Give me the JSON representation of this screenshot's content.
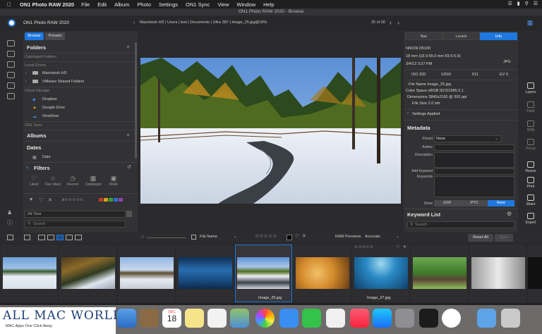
{
  "menubar": {
    "app": "ON1 Photo RAW 2020",
    "items": [
      "File",
      "Edit",
      "Album",
      "Photo",
      "Settings",
      "ON1 Sync",
      "View",
      "Window",
      "Help"
    ]
  },
  "window": {
    "title": "ON1 Photo RAW 2020 - Browse"
  },
  "header": {
    "app_name": "ON1 Photo RAW 2020",
    "path": "Macintosh HD | Users | test | Documents | Ultra 387 | Image_25.jpg@18%",
    "pager": "25 of 30"
  },
  "browse": {
    "tabs": [
      "Browse",
      "Presets"
    ],
    "folders_title": "Folders",
    "cataloged_folders": "Cataloged Folders",
    "local_drives": "Local Drives",
    "drives": [
      "Macintosh HD",
      "VMware Shared Folders"
    ],
    "cloud_storage": "Cloud Storage",
    "cloud": [
      "Dropbox",
      "Google Drive",
      "OneDrive"
    ],
    "on1_sync": "ON1 Sync",
    "albums_title": "Albums",
    "dates_title": "Dates",
    "date_item": "Date",
    "filters_title": "Filters",
    "filter_chips": [
      "Liked",
      "Five Stars",
      "Recent",
      "Cataloged",
      "Mode"
    ],
    "all_time": "All Time",
    "search_placeholder": "Search"
  },
  "info": {
    "tabs": [
      "Nav",
      "Levels",
      "Info"
    ],
    "camera": "NIKON D5100",
    "lens": "18 mm (18.0-55.0 mm f/3.5-5.6)",
    "date": "3/4/12 3:27 PM",
    "format": "JPG",
    "iso": "ISO 320",
    "shutter": "1/500",
    "aperture": "f/11",
    "ev": "EV 0",
    "file_name": "File Name Image_25.jpg",
    "color_space": "Color Space sRGB IEC61966-2.1",
    "dimensions": "Dimensions 3840x2160 @ 300 ppi",
    "file_size": "File Size 2.0 mb",
    "settings_applied": "Settings Applied",
    "metadata_title": "Metadata",
    "preset_label": "Preset",
    "preset_value": "None",
    "author_label": "Author",
    "description_label": "Description",
    "add_keyword_label": "Add Keyword",
    "keywords_label": "Keywords",
    "show_label": "Show",
    "show_options": [
      "EXIF",
      "IPTC",
      "None"
    ],
    "keyword_list_title": "Keyword List",
    "keyword_search_placeholder": "Search"
  },
  "modules": [
    "Layers",
    "Paint",
    "HDR",
    "Focus",
    "Resize",
    "Print",
    "Share",
    "Export"
  ],
  "bottombar": {
    "sort": "File Name",
    "raw_previews_label": "RAW Previews",
    "raw_previews_value": "Accurate",
    "reset_all": "Reset All",
    "sync": "Sync"
  },
  "filmstrip": {
    "labels": [
      "Image_25.jpg",
      "Image_27.jpg"
    ]
  },
  "watermark": {
    "title": "ALL MAC WORLDS",
    "subtitle": "MAC Apps One Click Away"
  },
  "dock_calendar": {
    "month": "DEC",
    "day": "18"
  },
  "colors": {
    "accent": "#1e78e0",
    "panel": "#323234",
    "background": "#2a2a2c"
  }
}
